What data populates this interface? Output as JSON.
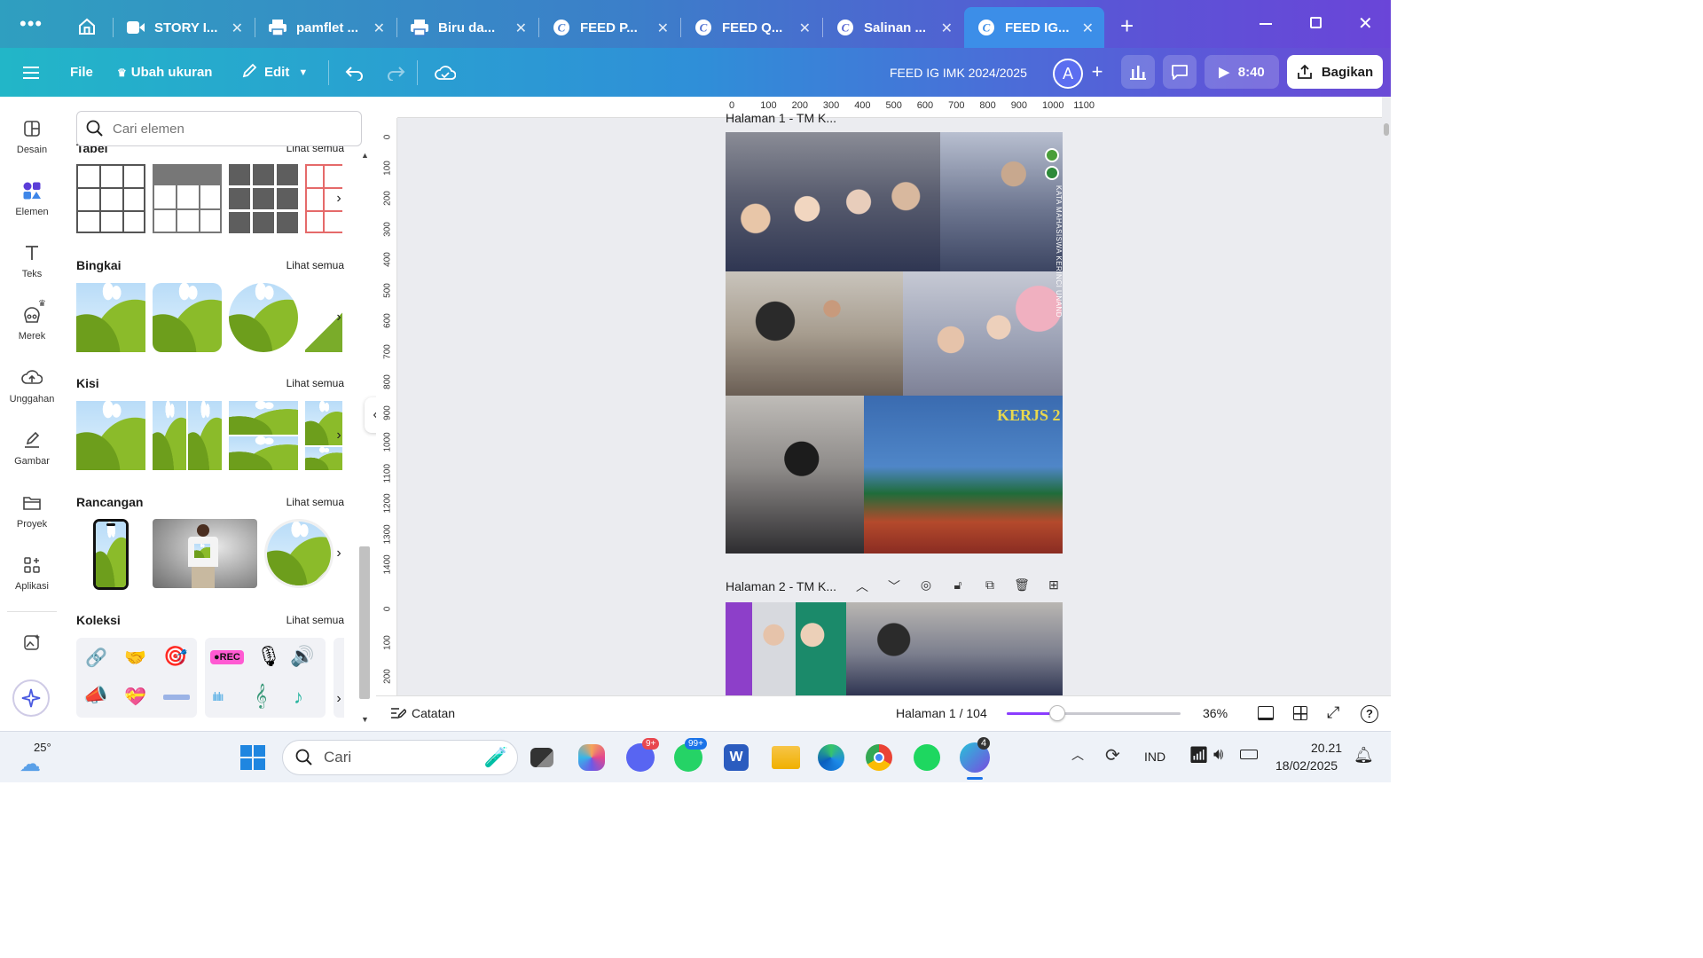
{
  "tabs": [
    {
      "label": "STORY I...",
      "icon": "video-icon"
    },
    {
      "label": "pamflet ...",
      "icon": "printer-icon"
    },
    {
      "label": "Biru da...",
      "icon": "printer-icon"
    },
    {
      "label": "FEED P...",
      "icon": "canva-icon"
    },
    {
      "label": "FEED Q...",
      "icon": "canva-icon"
    },
    {
      "label": "Salinan ...",
      "icon": "canva-icon"
    },
    {
      "label": "FEED IG...",
      "icon": "canva-icon"
    }
  ],
  "toolbar": {
    "file": "File",
    "resize": "Ubah ukuran",
    "edit": "Edit",
    "doc_title": "FEED IG IMK 2024/2025",
    "avatar": "A",
    "play_time": "8:40",
    "share": "Bagikan"
  },
  "rail": [
    {
      "label": "Desain",
      "icon": "design-icon"
    },
    {
      "label": "Elemen",
      "icon": "elements-icon"
    },
    {
      "label": "Teks",
      "icon": "text-icon"
    },
    {
      "label": "Merek",
      "icon": "brand-icon"
    },
    {
      "label": "Unggahan",
      "icon": "upload-icon"
    },
    {
      "label": "Gambar",
      "icon": "draw-icon"
    },
    {
      "label": "Proyek",
      "icon": "folder-icon"
    },
    {
      "label": "Aplikasi",
      "icon": "apps-icon"
    }
  ],
  "panel": {
    "search_placeholder": "Cari elemen",
    "see_all": "Lihat semua",
    "sections": [
      "Tabel",
      "Bingkai",
      "Kisi",
      "Rancangan",
      "Koleksi"
    ],
    "collection_badge": "●REC"
  },
  "ruler": {
    "top": [
      "0",
      "100",
      "200",
      "300",
      "400",
      "500",
      "600",
      "700",
      "800",
      "900",
      "1000",
      "1100"
    ],
    "left_page1": [
      "0",
      "100",
      "200",
      "300",
      "400",
      "500",
      "600",
      "700",
      "800",
      "900",
      "1000",
      "1100",
      "1200",
      "1300",
      "1400"
    ],
    "left_page2": [
      "0",
      "100",
      "200"
    ]
  },
  "canvas": {
    "page1_title": "Halaman 1 - TM K...",
    "page2_title": "Halaman 2 - TM K...",
    "vertical_text": "KATA MAHASISWA KERINCI UNAND"
  },
  "bottombar": {
    "notes": "Catatan",
    "page_indicator": "Halaman 1 / 104",
    "zoom": "36%",
    "zoom_level": 0.36
  },
  "taskbar": {
    "weather_temp": "25°",
    "search": "Cari",
    "discord_badge": "9+",
    "whatsapp_badge": "99+",
    "canva_badge": "4",
    "lang": "IND",
    "time": "20.21",
    "date": "18/02/2025"
  },
  "colors": {
    "accent": "#8b3dff",
    "tab_active": "#3c8ee8"
  }
}
